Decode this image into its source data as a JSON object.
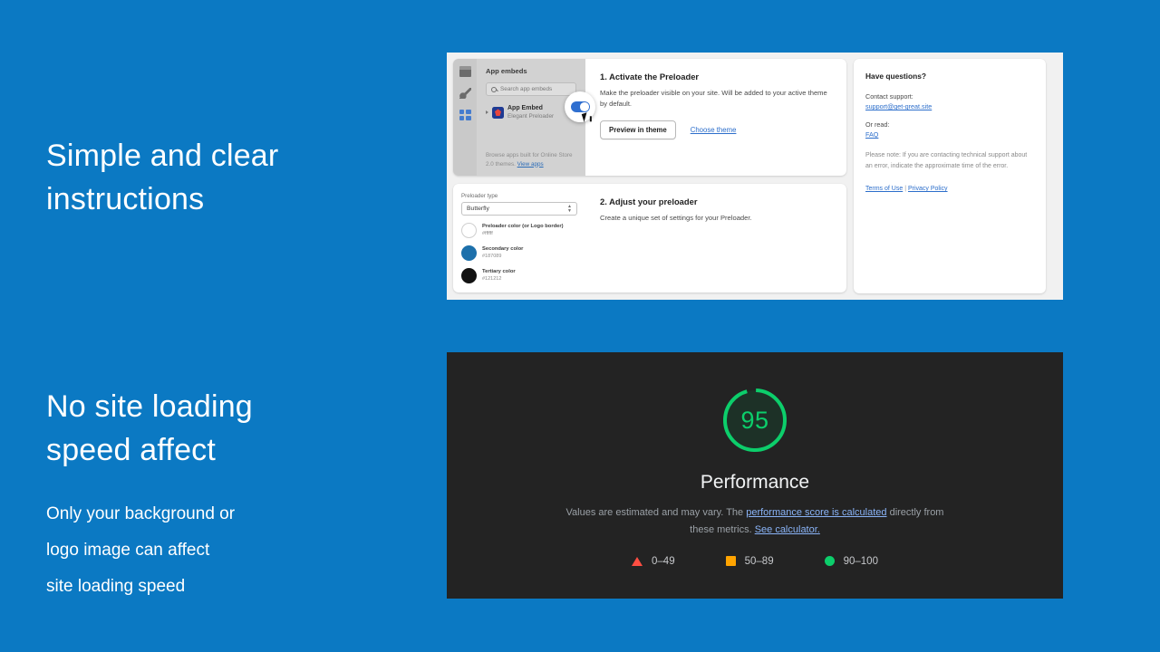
{
  "background_color": "#0b79c3",
  "copy": [
    {
      "id": "simple-clear",
      "headline": "Simple and clear\ninstructions"
    },
    {
      "id": "no-speed-affect",
      "headline": "No site loading\nspeed affect",
      "subcopy": "Only your background or\nlogo image can affect\nsite loading speed"
    }
  ],
  "shopify_panel": {
    "app_embeds": {
      "title": "App embeds",
      "search_placeholder": "Search app embeds",
      "embed_name": "App Embed",
      "embed_subtitle": "Elegant Preloader",
      "toggle_on": true,
      "footer_text": "Browse apps built for Online Store 2.0 themes.",
      "footer_link": "View apps"
    },
    "step_one": {
      "title": "1. Activate the Preloader",
      "description": "Make the preloader visible on your site. Will be added to your active theme by default.",
      "primary_button": "Preview in theme",
      "secondary_link": "Choose theme"
    },
    "step_two": {
      "title": "2. Adjust your preloader",
      "description": "Create a unique set of settings for your Preloader."
    },
    "settings": {
      "type_label": "Preloader type",
      "type_value": "Butterfly",
      "colors": [
        {
          "name": "Preloader color (or Logo border)",
          "hex": "#ffffff",
          "swatch": "#ffffff"
        },
        {
          "name": "Secondary color",
          "hex": "#187089",
          "swatch": "#1d70ab"
        },
        {
          "name": "Tertiary color",
          "hex": "#121212",
          "swatch": "#121212"
        }
      ]
    },
    "help": {
      "title": "Have questions?",
      "contact_label": "Contact support:",
      "contact_email": "support@get-great.site",
      "read_label": "Or read:",
      "read_link": "FAQ",
      "note": "Please note: If you are contacting technical support about an error, indicate the approximate time of the error.",
      "terms_link": "Terms of Use",
      "separator": "|",
      "privacy_link": "Privacy Policy"
    }
  },
  "lighthouse_panel": {
    "score": "95",
    "label": "Performance",
    "note_part1": "Values are estimated and may vary. The ",
    "note_link1": "performance score is calculated",
    "note_part2": " directly from these metrics. ",
    "note_link2": "See calculator.",
    "legend": [
      {
        "shape": "triangle",
        "range": "0–49",
        "color": "#ff4e42"
      },
      {
        "shape": "square",
        "range": "50–89",
        "color": "#ffa400"
      },
      {
        "shape": "circle",
        "range": "90–100",
        "color": "#0cce6b"
      }
    ]
  },
  "chart_data": {
    "type": "gauge",
    "title": "Performance",
    "value": 95,
    "range": [
      0,
      100
    ],
    "color": "#0cce6b",
    "thresholds": [
      {
        "label": "0–49",
        "min": 0,
        "max": 49,
        "color": "#ff4e42"
      },
      {
        "label": "50–89",
        "min": 50,
        "max": 89,
        "color": "#ffa400"
      },
      {
        "label": "90–100",
        "min": 90,
        "max": 100,
        "color": "#0cce6b"
      }
    ]
  }
}
